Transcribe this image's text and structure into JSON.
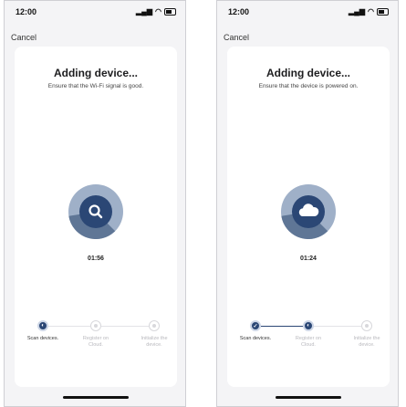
{
  "screens": [
    {
      "status_time": "12:00",
      "cancel_label": "Cancel",
      "title": "Adding device...",
      "subtitle": "Ensure that the Wi-Fi signal is good.",
      "center_icon": "search-icon",
      "progress_fraction": 0.35,
      "timer": "01:56",
      "steps": [
        {
          "label": "Scan devices.",
          "state": "active"
        },
        {
          "label": "Register on Cloud.",
          "state": "pending"
        },
        {
          "label": "Initialize the device.",
          "state": "pending"
        }
      ]
    },
    {
      "status_time": "12:00",
      "cancel_label": "Cancel",
      "title": "Adding device...",
      "subtitle": "Ensure that the device is powered on.",
      "center_icon": "cloud-icon",
      "progress_fraction": 0.35,
      "timer": "01:24",
      "steps": [
        {
          "label": "Scan devices.",
          "state": "done"
        },
        {
          "label": "Register on Cloud.",
          "state": "active"
        },
        {
          "label": "Initialize the device.",
          "state": "pending"
        }
      ]
    }
  ],
  "colors": {
    "accent": "#2b4775",
    "ring_light": "#9fb0c8",
    "ring_mid": "#5f7696",
    "pending": "#d8d8dc"
  }
}
